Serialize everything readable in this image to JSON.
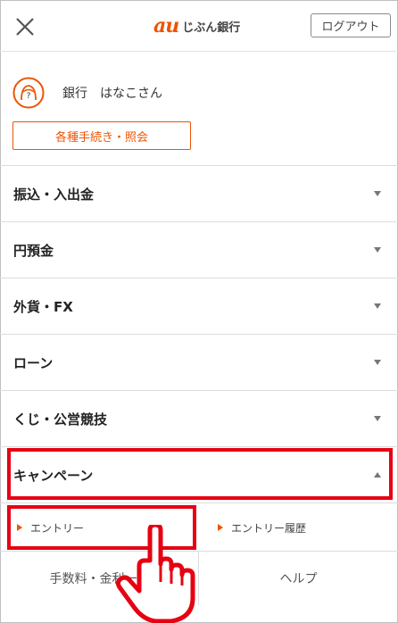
{
  "header": {
    "close_icon": "close-icon",
    "brand_mark": "au",
    "brand_name": "じぶん銀行",
    "logout_label": "ログアウト"
  },
  "user": {
    "avatar_icon": "user-avatar-icon",
    "name": "銀行　はなこさん"
  },
  "procedures_label": "各種手続き・照会",
  "menu": [
    {
      "label": "振込・入出金",
      "expanded": false
    },
    {
      "label": "円預金",
      "expanded": false
    },
    {
      "label": "外貨・FX",
      "expanded": false
    },
    {
      "label": "ローン",
      "expanded": false
    },
    {
      "label": "くじ・公営競技",
      "expanded": false
    },
    {
      "label": "キャンペーン",
      "expanded": true
    }
  ],
  "campaign_submenu": [
    {
      "label": "エントリー"
    },
    {
      "label": "エントリー履歴"
    }
  ],
  "footer": {
    "fees_label": "手数料・金利一覧",
    "help_label": "ヘルプ"
  },
  "colors": {
    "brand_orange": "#eb5505",
    "highlight_red": "#e60012"
  },
  "annotation": {
    "pointer_icon": "pointing-hand-icon"
  }
}
